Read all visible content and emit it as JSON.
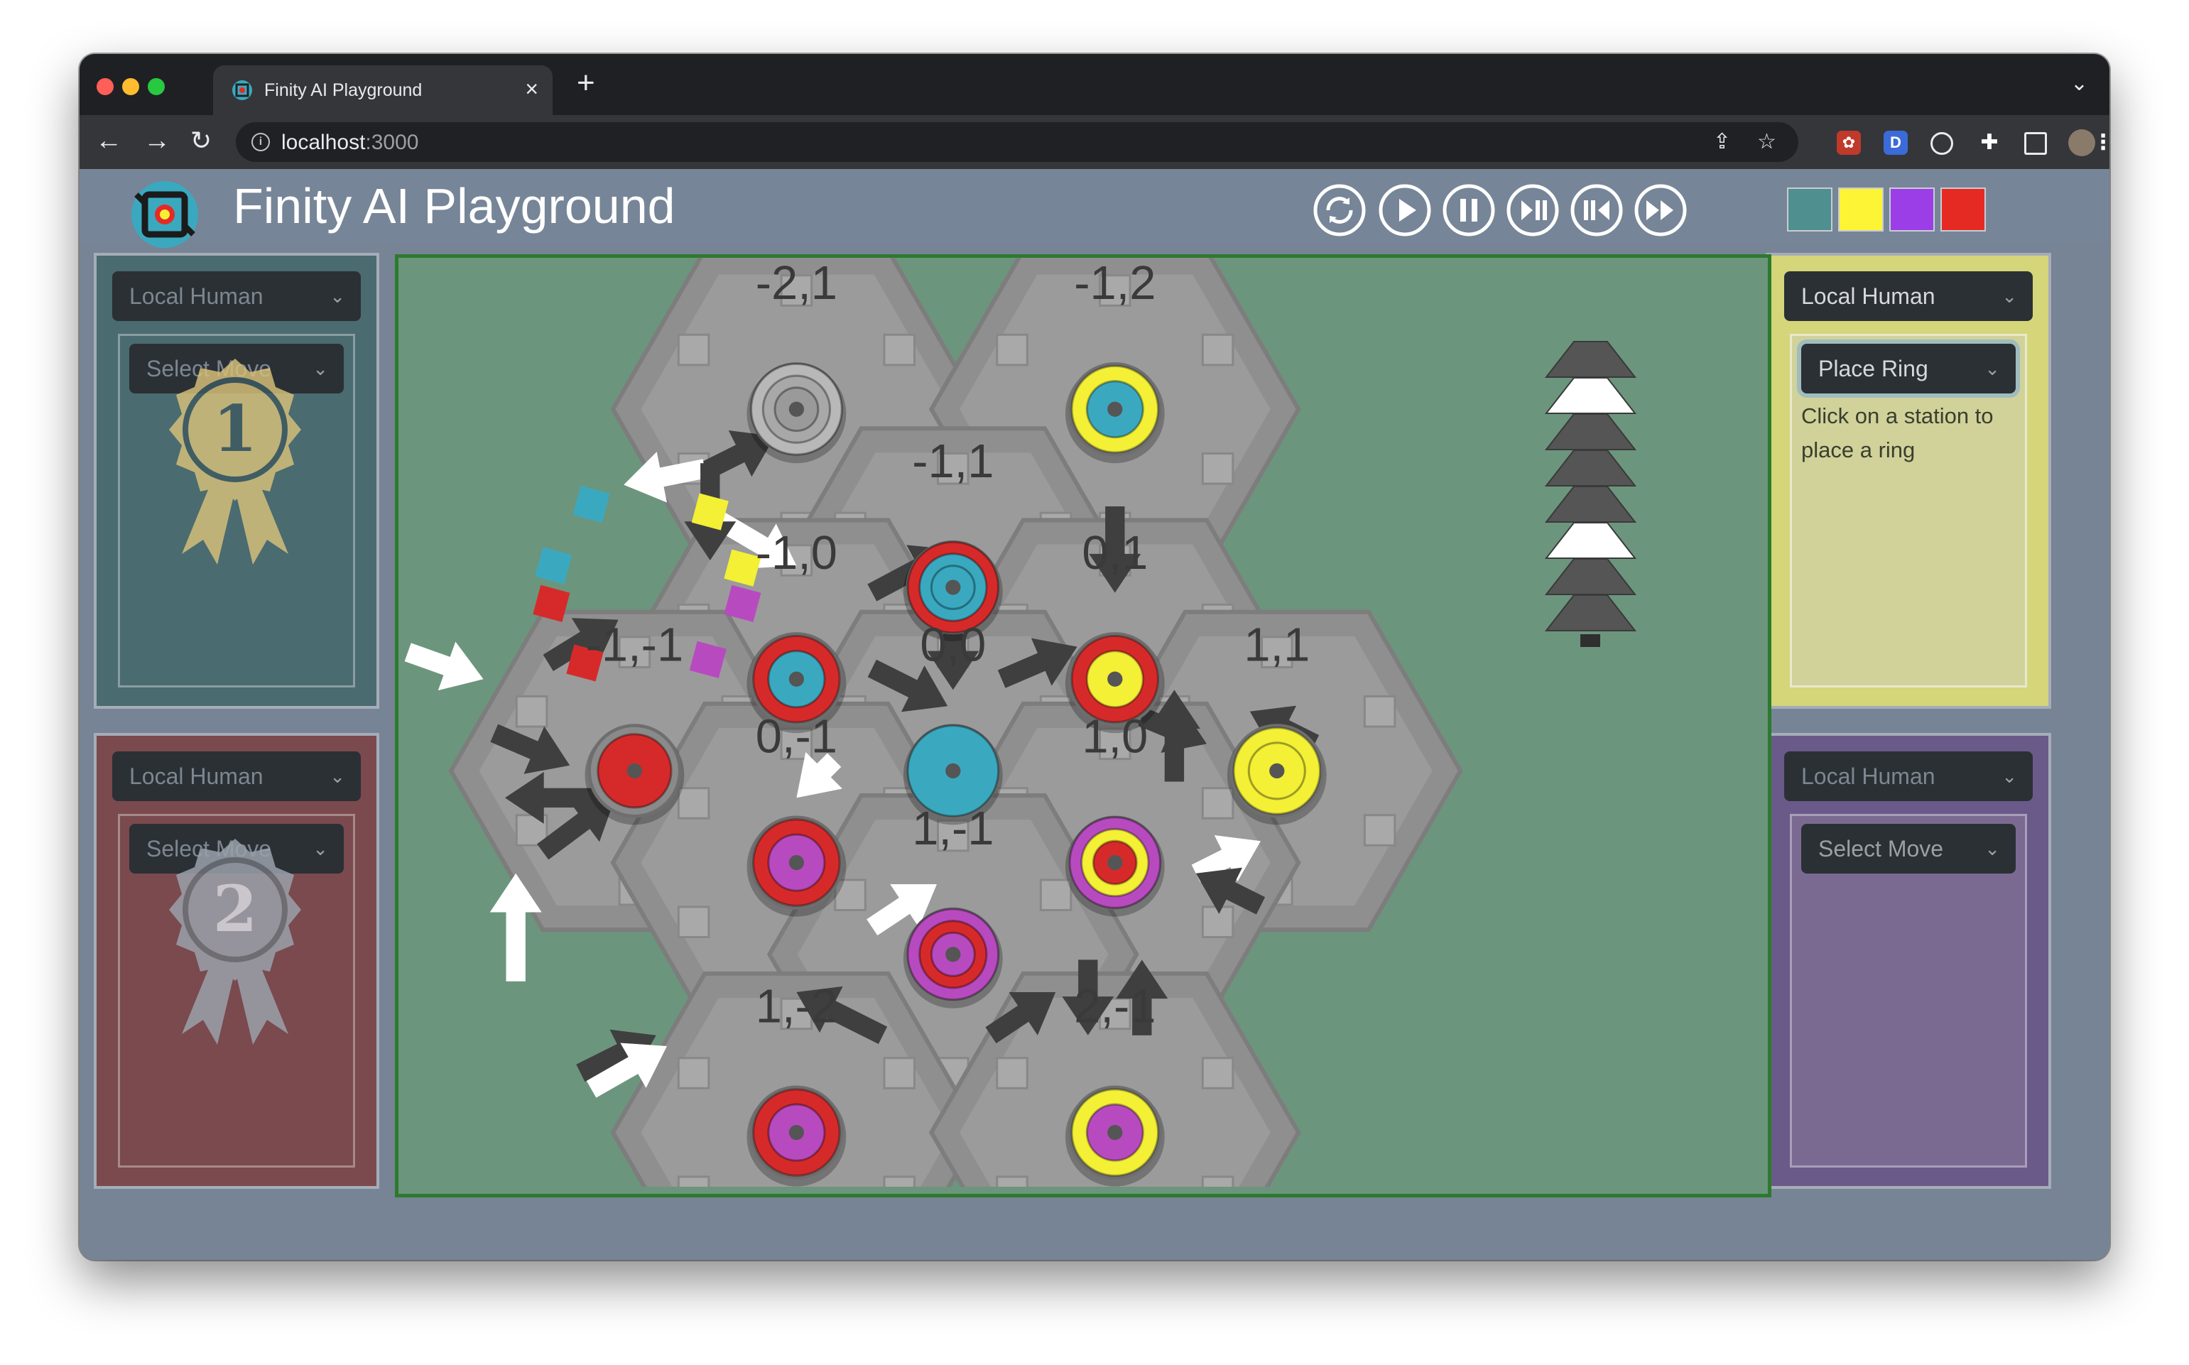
{
  "browser": {
    "tab_title": "Finity AI Playground",
    "url_host": "localhost",
    "url_port": ":3000"
  },
  "app": {
    "title": "Finity AI Playground",
    "controls": [
      "reset-icon",
      "play-icon",
      "pause-icon",
      "step-icon",
      "step-back-icon",
      "fast-forward-icon"
    ],
    "player_swatches": [
      "#4f8f8f",
      "#fcf434",
      "#9b3ee8",
      "#e52a24"
    ]
  },
  "players": [
    {
      "controller": "Local Human",
      "move": "Select Move",
      "badge": "1",
      "panel_color": "#4a6b70"
    },
    {
      "controller": "Local Human",
      "move": "Select Move",
      "badge": "2",
      "panel_color": "#7a4a4e"
    },
    {
      "controller": "Local Human",
      "move": "Place Ring",
      "hint": "Click on a station to place a ring",
      "panel_color": "#d5d57a"
    },
    {
      "controller": "Local Human",
      "move": "Select Move",
      "panel_color": "#6a5a8a"
    }
  ],
  "board": {
    "tiles": [
      {
        "label": "-2,1",
        "rings": [
          "#b8b8b8",
          "#a8a8a8",
          "#9a9a9a"
        ]
      },
      {
        "label": "-1,2",
        "rings": [
          "#f3f035",
          "#3aa9c0"
        ]
      },
      {
        "label": "-1,1",
        "rings": [
          "#d62a2a",
          "#3aa9c0",
          "#3aa9c0"
        ]
      },
      {
        "label": "-1,0",
        "rings": [
          "#d62a2a",
          "#3aa9c0"
        ]
      },
      {
        "label": "0,1",
        "rings": [
          "#d62a2a",
          "#f3f035"
        ]
      },
      {
        "label": "-1,-1",
        "rings": [
          "#d62a2a"
        ]
      },
      {
        "label": "0,0",
        "rings": [
          "#3aa9c0"
        ]
      },
      {
        "label": "1,1",
        "rings": [
          "#f3f035",
          "#f3f035"
        ]
      },
      {
        "label": "0,-1",
        "rings": [
          "#d62a2a",
          "#b84ac0"
        ]
      },
      {
        "label": "1,0",
        "rings": [
          "#b84ac0",
          "#f3f035",
          "#d62a2a"
        ]
      },
      {
        "label": "1,-1",
        "rings": [
          "#b84ac0",
          "#d62a2a",
          "#b84ac0"
        ]
      },
      {
        "label": "1,-2",
        "rings": [
          "#d62a2a",
          "#b84ac0"
        ]
      },
      {
        "label": "2,-1",
        "rings": [
          "#f3f035",
          "#b84ac0"
        ]
      }
    ],
    "stack": [
      "dark",
      "white",
      "dark",
      "dark",
      "dark",
      "white",
      "dark",
      "dark"
    ]
  }
}
